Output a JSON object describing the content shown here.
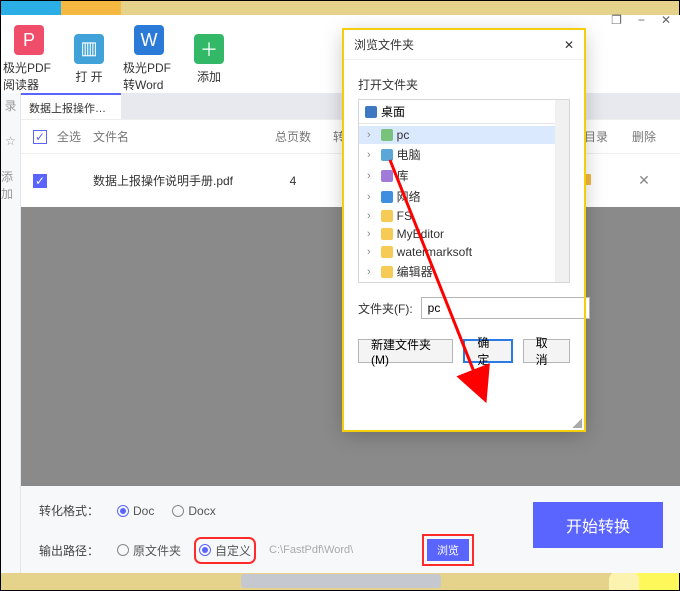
{
  "decor_left_colors": [
    "#2baee6",
    "#f5b942"
  ],
  "titlebar": {
    "help": "❐",
    "min": "−",
    "close": "✕"
  },
  "toolbar": [
    {
      "name": "pdf-reader",
      "label": "极光PDF阅读器",
      "color": "#f04d6b"
    },
    {
      "name": "open",
      "label": "打 开",
      "color": "#40a2d8"
    },
    {
      "name": "pdf-to-word",
      "label": "极光PDF转Word",
      "color": "#2b7ad8"
    },
    {
      "name": "add",
      "label": "添加",
      "color": "#32b867"
    }
  ],
  "tab": "数据上报操作说明手册.p",
  "side": {
    "record": "录",
    "star": "☆",
    "add": "添加"
  },
  "header": {
    "all": "全选",
    "name": "文件名",
    "pages": "总页数",
    "conv": "转",
    "open": "打开目录",
    "del": "删除"
  },
  "row": {
    "name": "数据上报操作说明手册.pdf",
    "pages": "4",
    "del": "✕"
  },
  "bottom": {
    "fmt_label": "转化格式：",
    "fmt_doc": "Doc",
    "fmt_docx": "Docx",
    "out_label": "输出路径：",
    "out_src": "原文件夹",
    "out_custom": "自定义",
    "path": "C:\\FastPdf\\Word\\",
    "browse": "浏览",
    "start": "开始转换"
  },
  "dialog": {
    "title": "浏览文件夹",
    "close": "✕",
    "sub": "打开文件夹",
    "root": "桌面",
    "items": [
      {
        "label": "pc",
        "color": "#79c27b",
        "selected": true
      },
      {
        "label": "电脑",
        "color": "#5aa7d8"
      },
      {
        "label": "库",
        "color": "#a07cd8"
      },
      {
        "label": "网络",
        "color": "#3f8fe0"
      },
      {
        "label": "FS",
        "color": "#f5cb55"
      },
      {
        "label": "MyEditor",
        "color": "#f5cb55"
      },
      {
        "label": "watermarksoft",
        "color": "#f5cb55"
      },
      {
        "label": "编辑器",
        "color": "#f5cb55"
      }
    ],
    "folder_label": "文件夹(F):",
    "folder_value": "pc",
    "new": "新建文件夹(M)",
    "ok": "确定",
    "cancel": "取消"
  }
}
